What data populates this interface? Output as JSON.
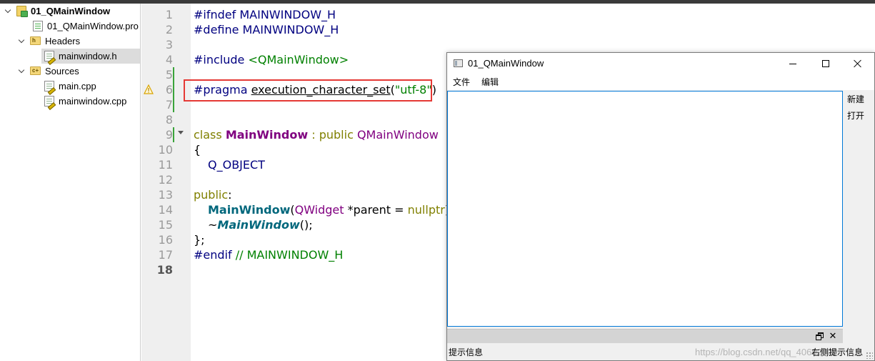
{
  "project_tree": {
    "project_name": "01_QMainWindow",
    "pro_file": "01_QMainWindow.pro",
    "headers_label": "Headers",
    "header_files": [
      "mainwindow.h"
    ],
    "sources_label": "Sources",
    "source_files": [
      "main.cpp",
      "mainwindow.cpp"
    ],
    "selected_file": "mainwindow.h"
  },
  "editor": {
    "line_numbers": [
      "1",
      "2",
      "3",
      "4",
      "5",
      "6",
      "7",
      "8",
      "9",
      "10",
      "11",
      "12",
      "13",
      "14",
      "15",
      "16",
      "17",
      "18"
    ],
    "current_line": "18",
    "code": {
      "l1_pp": "#ifndef MAINWINDOW_H",
      "l2_pp": "#define MAINWINDOW_H",
      "l4_pp": "#include ",
      "l4_str": "<QMainWindow>",
      "l6_pp": "#pragma ",
      "l6_fn": "execution_character_set",
      "l6_open": "(",
      "l6_str": "\"utf-8\"",
      "l6_close": ")",
      "l9_kw": "class ",
      "l9_cls": "MainWindow",
      "l9_sep": " : ",
      "l9_kw2": "public ",
      "l9_typ": "QMainWindow",
      "l10": "{",
      "l11": "Q_OBJECT",
      "l13_kw": "public",
      "l13_colon": ":",
      "l14_fn": "MainWindow",
      "l14_open": "(",
      "l14_typ": "QWidget",
      "l14_rest": " *parent = ",
      "l14_kw": "nullptr",
      "l14_close": ");",
      "l15_tilde": "~",
      "l15_fn": "MainWindow",
      "l15_rest": "();",
      "l16": "};",
      "l17_pp": "#endif ",
      "l17_cm": "// MAINWINDOW_H"
    },
    "highlight_color": "#e53935"
  },
  "app_window": {
    "title": "01_QMainWindow",
    "menus": [
      "文件",
      "编辑"
    ],
    "toolbar_actions": [
      "新建",
      "打开"
    ],
    "dock_float_symbol": "",
    "dock_close_symbol": "✕",
    "status_left": "提示信息",
    "status_right": "右侧提示信息",
    "watermark": "https://blog.csdn.net/qq_40602000"
  },
  "icons": [
    "chevron-down-icon",
    "project-icon",
    "folder-icon",
    "file-icon",
    "warning-icon",
    "fold-arrow-icon",
    "minimize-icon",
    "maximize-icon",
    "close-icon",
    "dock-float-icon",
    "dock-close-icon",
    "size-grip-icon"
  ]
}
